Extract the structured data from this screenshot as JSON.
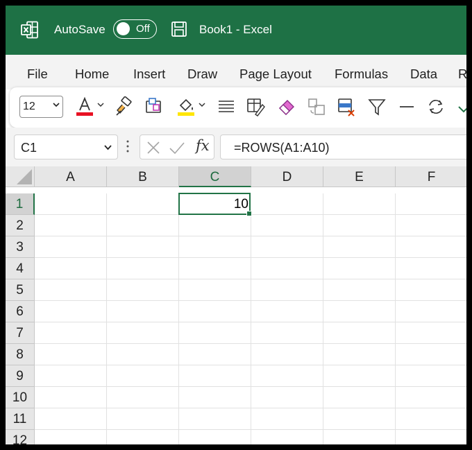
{
  "titlebar": {
    "autosave_label": "AutoSave",
    "autosave_state": "Off",
    "doc_title": "Book1  -  Excel",
    "background": "#1e7145"
  },
  "menu": {
    "items": [
      "File",
      "Home",
      "Insert",
      "Draw",
      "Page Layout",
      "Formulas",
      "Data",
      "Re"
    ]
  },
  "ribbon": {
    "font_size": "12",
    "icons": [
      "font-color-icon",
      "format-painter-icon",
      "styles-icon",
      "fill-color-icon",
      "align-icon",
      "format-cells-icon",
      "clear-icon",
      "copy-format-icon",
      "delete-cells-icon",
      "filter-icon",
      "line-icon",
      "refresh-icon",
      "check-icon"
    ],
    "font_color": "#e81123",
    "fill_color": "#ffe600"
  },
  "formula_bar": {
    "name_box": "C1",
    "formula": "=ROWS(A1:A10)",
    "fx_label": "fx"
  },
  "sheet": {
    "columns": [
      "A",
      "B",
      "C",
      "D",
      "E",
      "F"
    ],
    "rows": [
      "1",
      "2",
      "3",
      "4",
      "5",
      "6",
      "7",
      "8",
      "9",
      "10",
      "11",
      "12"
    ],
    "active_cell": "C1",
    "cells": {
      "C1": "10"
    },
    "accent": "#217346"
  }
}
